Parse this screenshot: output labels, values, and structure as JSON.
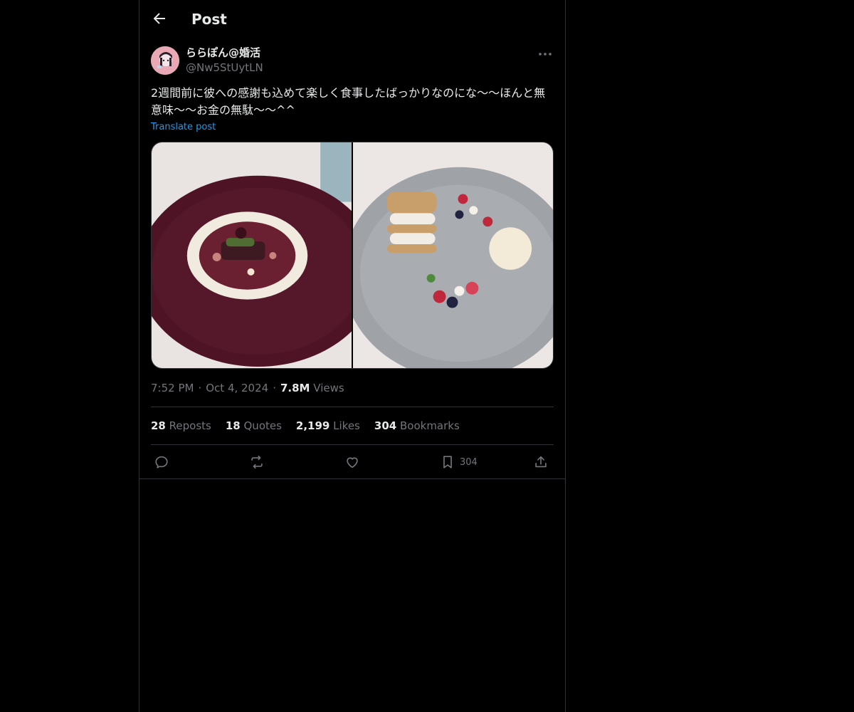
{
  "header": {
    "title": "Post"
  },
  "author": {
    "display_name": "ららぽん@婚活",
    "handle": "@Nw5StUytLN"
  },
  "post": {
    "text": "2週間前に彼への感謝も込めて楽しく食事したばっかりなのにな〜〜ほんと無意味〜〜お金の無駄〜〜^^",
    "translate_label": "Translate post",
    "time": "7:52 PM",
    "date": "Oct 4, 2024",
    "views_count": "7.8M",
    "views_label": "Views"
  },
  "stats": {
    "reposts_count": "28",
    "reposts_label": "Reposts",
    "quotes_count": "18",
    "quotes_label": "Quotes",
    "likes_count": "2,199",
    "likes_label": "Likes",
    "bookmarks_count": "304",
    "bookmarks_label": "Bookmarks"
  },
  "actions": {
    "bookmark_count": "304"
  },
  "colors": {
    "background": "#000000",
    "text": "#e7e9ea",
    "muted": "#71767b",
    "link": "#1d9bf0",
    "border": "#2f3336"
  },
  "icons": [
    "back-arrow-icon",
    "more-dots-icon",
    "reply-icon",
    "repost-icon",
    "like-heart-icon",
    "bookmark-icon",
    "share-icon"
  ]
}
